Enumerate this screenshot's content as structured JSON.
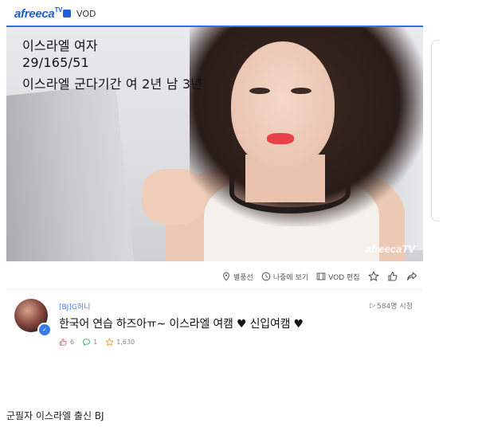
{
  "header": {
    "logo_text": "afreeca",
    "logo_sup": "TV",
    "section": "VOD",
    "accent": "#2f6fe8"
  },
  "video": {
    "overlay_lines": [
      "이스라엘 여자",
      "29/165/51",
      "이스라엘 군다기간  여 2년 남 3년"
    ],
    "watermark": "afreecaTV"
  },
  "actions": [
    {
      "icon": "location-icon",
      "label": "별풍선"
    },
    {
      "icon": "clock-icon",
      "label": "나중에 보기"
    },
    {
      "icon": "film-icon",
      "label": "VOD 편집"
    },
    {
      "icon": "star-icon",
      "label": ""
    },
    {
      "icon": "thumbs-up-icon",
      "label": ""
    },
    {
      "icon": "share-icon",
      "label": ""
    }
  ],
  "info": {
    "channel": "[BJ]G허니",
    "views": "584명 시청",
    "title": "한국어 연습 하즈아ㅠ~ 이스라엘 여캠 ♥ 신입여캠 ♥",
    "stats": {
      "likes": "6",
      "comments": "1",
      "favorites": "1,630"
    }
  },
  "caption": "군필자 이스라엘 출신 BJ"
}
